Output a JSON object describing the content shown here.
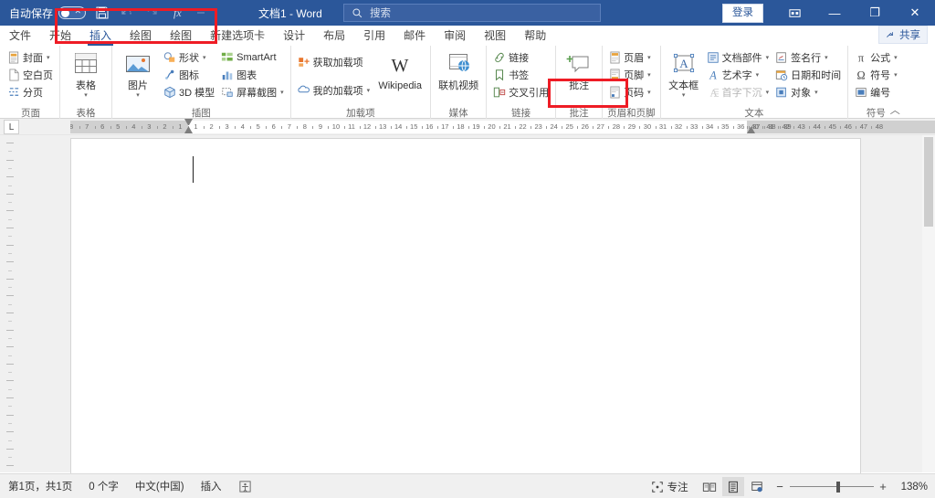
{
  "titlebar": {
    "autosave_label": "自动保存",
    "autosave_state": "off",
    "doc_title": "文档1  -  Word",
    "search_placeholder": "搜索",
    "signin_label": "登录",
    "minimize_label": "—",
    "restore_label": "❐",
    "close_label": "✕"
  },
  "tabs": [
    {
      "label": "文件",
      "active": false
    },
    {
      "label": "开始",
      "active": false
    },
    {
      "label": "插入",
      "active": true
    },
    {
      "label": "绘图",
      "active": false
    },
    {
      "label": "绘图",
      "active": false
    },
    {
      "label": "新建选项卡",
      "active": false
    },
    {
      "label": "设计",
      "active": false
    },
    {
      "label": "布局",
      "active": false
    },
    {
      "label": "引用",
      "active": false
    },
    {
      "label": "邮件",
      "active": false
    },
    {
      "label": "审阅",
      "active": false
    },
    {
      "label": "视图",
      "active": false
    },
    {
      "label": "帮助",
      "active": false
    }
  ],
  "share": {
    "label": "共享"
  },
  "ribbon": {
    "groups": [
      {
        "label": "页面",
        "items": [
          {
            "label": "封面",
            "icon": "cover-page-icon",
            "dropdown": true
          },
          {
            "label": "空白页",
            "icon": "blank-page-icon",
            "dropdown": false
          },
          {
            "label": "分页",
            "icon": "page-break-icon",
            "dropdown": false
          }
        ]
      },
      {
        "label": "表格",
        "items": [
          {
            "label": "表格",
            "icon": "table-icon",
            "dropdown": true
          }
        ]
      },
      {
        "label": "插图",
        "items": [
          {
            "label": "图片",
            "icon": "pictures-icon",
            "dropdown": true
          },
          {
            "label": "形状",
            "icon": "shapes-icon",
            "dropdown": true
          },
          {
            "label": "图标",
            "icon": "icons-icon",
            "dropdown": false
          },
          {
            "label": "3D 模型",
            "icon": "3d-model-icon",
            "dropdown": false
          },
          {
            "label": "SmartArt",
            "icon": "smartart-icon",
            "dropdown": false
          },
          {
            "label": "图表",
            "icon": "chart-icon",
            "dropdown": false
          },
          {
            "label": "屏幕截图",
            "icon": "screenshot-icon",
            "dropdown": true
          }
        ]
      },
      {
        "label": "加载项",
        "items": [
          {
            "label": "获取加载项",
            "icon": "get-addins-icon",
            "dropdown": false
          },
          {
            "label": "我的加载项",
            "icon": "my-addins-icon",
            "dropdown": true
          },
          {
            "label": "Wikipedia",
            "icon": "wikipedia-icon",
            "dropdown": false
          }
        ]
      },
      {
        "label": "媒体",
        "items": [
          {
            "label": "联机视频",
            "icon": "online-video-icon",
            "dropdown": false
          }
        ]
      },
      {
        "label": "链接",
        "items": [
          {
            "label": "链接",
            "icon": "link-icon",
            "dropdown": false
          },
          {
            "label": "书签",
            "icon": "bookmark-icon",
            "dropdown": false
          },
          {
            "label": "交叉引用",
            "icon": "cross-reference-icon",
            "dropdown": false
          }
        ]
      },
      {
        "label": "批注",
        "items": [
          {
            "label": "批注",
            "icon": "new-comment-icon",
            "dropdown": false
          }
        ]
      },
      {
        "label": "页眉和页脚",
        "items": [
          {
            "label": "页眉",
            "icon": "header-icon",
            "dropdown": true
          },
          {
            "label": "页脚",
            "icon": "footer-icon",
            "dropdown": true
          },
          {
            "label": "页码",
            "icon": "page-number-icon",
            "dropdown": true
          }
        ]
      },
      {
        "label": "文本",
        "items": [
          {
            "label": "文本框",
            "icon": "text-box-icon",
            "dropdown": true
          },
          {
            "label": "文档部件",
            "icon": "quick-parts-icon",
            "dropdown": true
          },
          {
            "label": "艺术字",
            "icon": "wordart-icon",
            "dropdown": true
          },
          {
            "label": "首字下沉",
            "icon": "drop-cap-icon",
            "dropdown": true,
            "disabled": true
          },
          {
            "label": "签名行",
            "icon": "signature-line-icon",
            "dropdown": true
          },
          {
            "label": "日期和时间",
            "icon": "date-time-icon",
            "dropdown": false
          },
          {
            "label": "对象",
            "icon": "object-icon",
            "dropdown": true
          }
        ]
      },
      {
        "label": "符号",
        "items": [
          {
            "label": "公式",
            "icon": "equation-icon",
            "dropdown": true
          },
          {
            "label": "符号",
            "icon": "symbol-icon",
            "dropdown": true
          },
          {
            "label": "编号",
            "icon": "number-icon",
            "dropdown": false
          }
        ]
      }
    ],
    "collapse_label": "︿"
  },
  "ruler": {
    "left_labels": [
      "8",
      "7",
      "6",
      "5",
      "4",
      "3",
      "2",
      "1"
    ],
    "body_labels": [
      "1",
      "2",
      "3",
      "4",
      "5",
      "6",
      "7",
      "8",
      "9",
      "10",
      "11",
      "12",
      "13",
      "14",
      "15",
      "16",
      "17",
      "18",
      "19",
      "20",
      "21",
      "22",
      "23",
      "24",
      "25",
      "26",
      "27",
      "28",
      "29",
      "30",
      "31",
      "32",
      "33",
      "34",
      "35",
      "36",
      "37",
      "38",
      "39"
    ],
    "right_labels": [
      "40",
      "41",
      "42",
      "43",
      "44",
      "45",
      "46",
      "47",
      "48"
    ],
    "tab_selector": "L"
  },
  "statusbar": {
    "page_info": "第1页，共1页",
    "word_count": "0 个字",
    "language": "中文(中国)",
    "insert_mode": "插入",
    "accessibility_icon": "accessibility-checker-icon",
    "focus_label": "专注",
    "view_read": "read-mode-icon",
    "view_print": "print-layout-icon",
    "view_web": "web-layout-icon",
    "zoom_out": "−",
    "zoom_in": "+",
    "zoom_value": "138%"
  },
  "annotations": {
    "box1_target": "insert-tab-group",
    "box2_target": "page-number-button",
    "color": "#ee1c25"
  }
}
